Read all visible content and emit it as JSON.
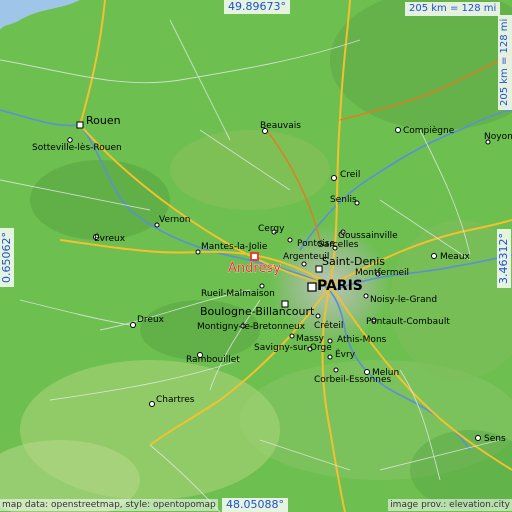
{
  "coordinates": {
    "north": "49.89673°",
    "south": "48.05088°",
    "west": "0.65062°",
    "east": "3.46312°"
  },
  "scale": {
    "top": "205 km = 128 mi",
    "right": "205 km = 128 mi"
  },
  "credits": {
    "left": "map data: openstreetmap, style: opentopomap",
    "right": "image prov.: elevation.city"
  },
  "highlight": {
    "name": "Andresy",
    "color": "#e8332b"
  },
  "cities": [
    {
      "name": "Rouen"
    },
    {
      "name": "Sotteville-lès-Rouen"
    },
    {
      "name": "Beauvais"
    },
    {
      "name": "Compiègne"
    },
    {
      "name": "Noyon"
    },
    {
      "name": "Creil"
    },
    {
      "name": "Senlis"
    },
    {
      "name": "Vernon"
    },
    {
      "name": "Évreux"
    },
    {
      "name": "Cergy"
    },
    {
      "name": "Pontoise"
    },
    {
      "name": "Mantes-la-Jolie"
    },
    {
      "name": "Argenteuil"
    },
    {
      "name": "Sarcelles"
    },
    {
      "name": "Goussainville"
    },
    {
      "name": "Saint-Denis"
    },
    {
      "name": "Meaux"
    },
    {
      "name": "Montfermeil"
    },
    {
      "name": "PARIS"
    },
    {
      "name": "Rueil-Malmaison"
    },
    {
      "name": "Noisy-le-Grand"
    },
    {
      "name": "Dreux"
    },
    {
      "name": "Boulogne-Billancourt"
    },
    {
      "name": "Créteil"
    },
    {
      "name": "Pontault-Combault"
    },
    {
      "name": "Montigny-le-Bretonneux"
    },
    {
      "name": "Massy"
    },
    {
      "name": "Athis-Mons"
    },
    {
      "name": "Rambouillet"
    },
    {
      "name": "Savigny-sur-Orge"
    },
    {
      "name": "Évry"
    },
    {
      "name": "Corbeil-Essonnes"
    },
    {
      "name": "Melun"
    },
    {
      "name": "Chartres"
    },
    {
      "name": "Sens"
    }
  ]
}
